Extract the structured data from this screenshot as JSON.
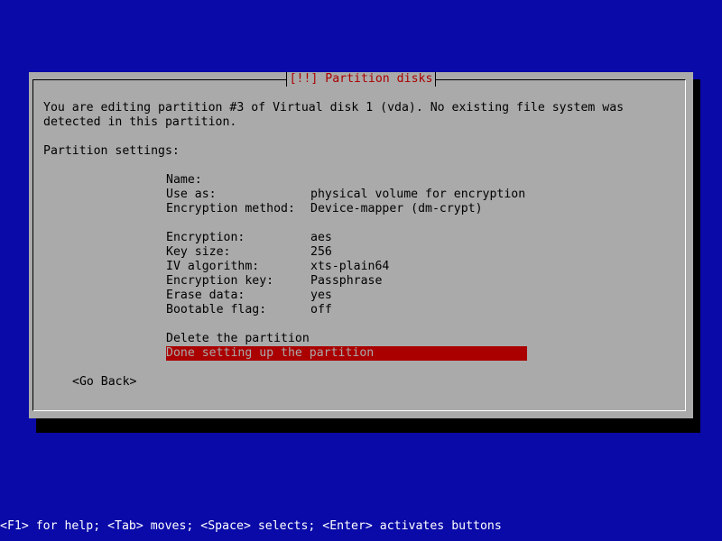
{
  "dialog": {
    "title": "[!!] Partition disks",
    "intro_line1": "You are editing partition #3 of Virtual disk 1 (vda). No existing file system was",
    "intro_line2": "detected in this partition.",
    "settings_heading": "Partition settings:"
  },
  "settings": [
    {
      "label": "Name:",
      "value": ""
    },
    {
      "label": "Use as:",
      "value": "physical volume for encryption"
    },
    {
      "label": "Encryption method:",
      "value": "Device-mapper (dm-crypt)"
    },
    {
      "label": "Encryption:",
      "value": "aes"
    },
    {
      "label": "Key size:",
      "value": "256"
    },
    {
      "label": "IV algorithm:",
      "value": "xts-plain64"
    },
    {
      "label": "Encryption key:",
      "value": "Passphrase"
    },
    {
      "label": "Erase data:",
      "value": "yes"
    },
    {
      "label": "Bootable flag:",
      "value": "off"
    }
  ],
  "actions": {
    "delete": "Delete the partition",
    "done": "Done setting up the partition"
  },
  "buttons": {
    "go_back": "<Go Back>"
  },
  "statusbar": "<F1> for help; <Tab> moves; <Space> selects; <Enter> activates buttons",
  "colors": {
    "background": "#0a0aa8",
    "dialog": "#aaaaaa",
    "title": "#aa0000",
    "selection": "#aa0000"
  }
}
